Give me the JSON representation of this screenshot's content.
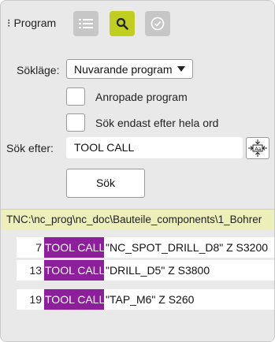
{
  "toolbar": {
    "menu_glyph": "⁝",
    "title": "Program",
    "buttons": [
      {
        "icon": "list-icon",
        "active": false
      },
      {
        "icon": "search-icon",
        "active": true
      },
      {
        "icon": "check-circle-icon",
        "active": false
      }
    ]
  },
  "search_mode": {
    "label": "Sökläge:",
    "selected": "Nuvarande program"
  },
  "options": [
    {
      "label": "Anropade program",
      "checked": false
    },
    {
      "label": "Sök endast efter hela ord",
      "checked": false
    }
  ],
  "search_for": {
    "label": "Sök efter:",
    "value": "TOOL CALL"
  },
  "search_button": {
    "label": "Sök"
  },
  "path": "TNC:\\nc_prog\\nc_doc\\Bauteile_components\\1_Bohrer",
  "results": [
    {
      "line": "7",
      "match": "TOOL CALL",
      "rest": "\"NC_SPOT_DRILL_D8\" Z S3200"
    },
    {
      "line": "13",
      "match": "TOOL CALL",
      "rest": "\"DRILL_D5\" Z S3800"
    },
    {
      "line": "19",
      "match": "TOOL CALL",
      "rest": "\"TAP_M6\" Z S260"
    }
  ],
  "colors": {
    "active_button": "#bfce1f",
    "highlight": "#8e1f9c",
    "path_bar": "#ecefb9",
    "panel": "#e9e9e9"
  }
}
